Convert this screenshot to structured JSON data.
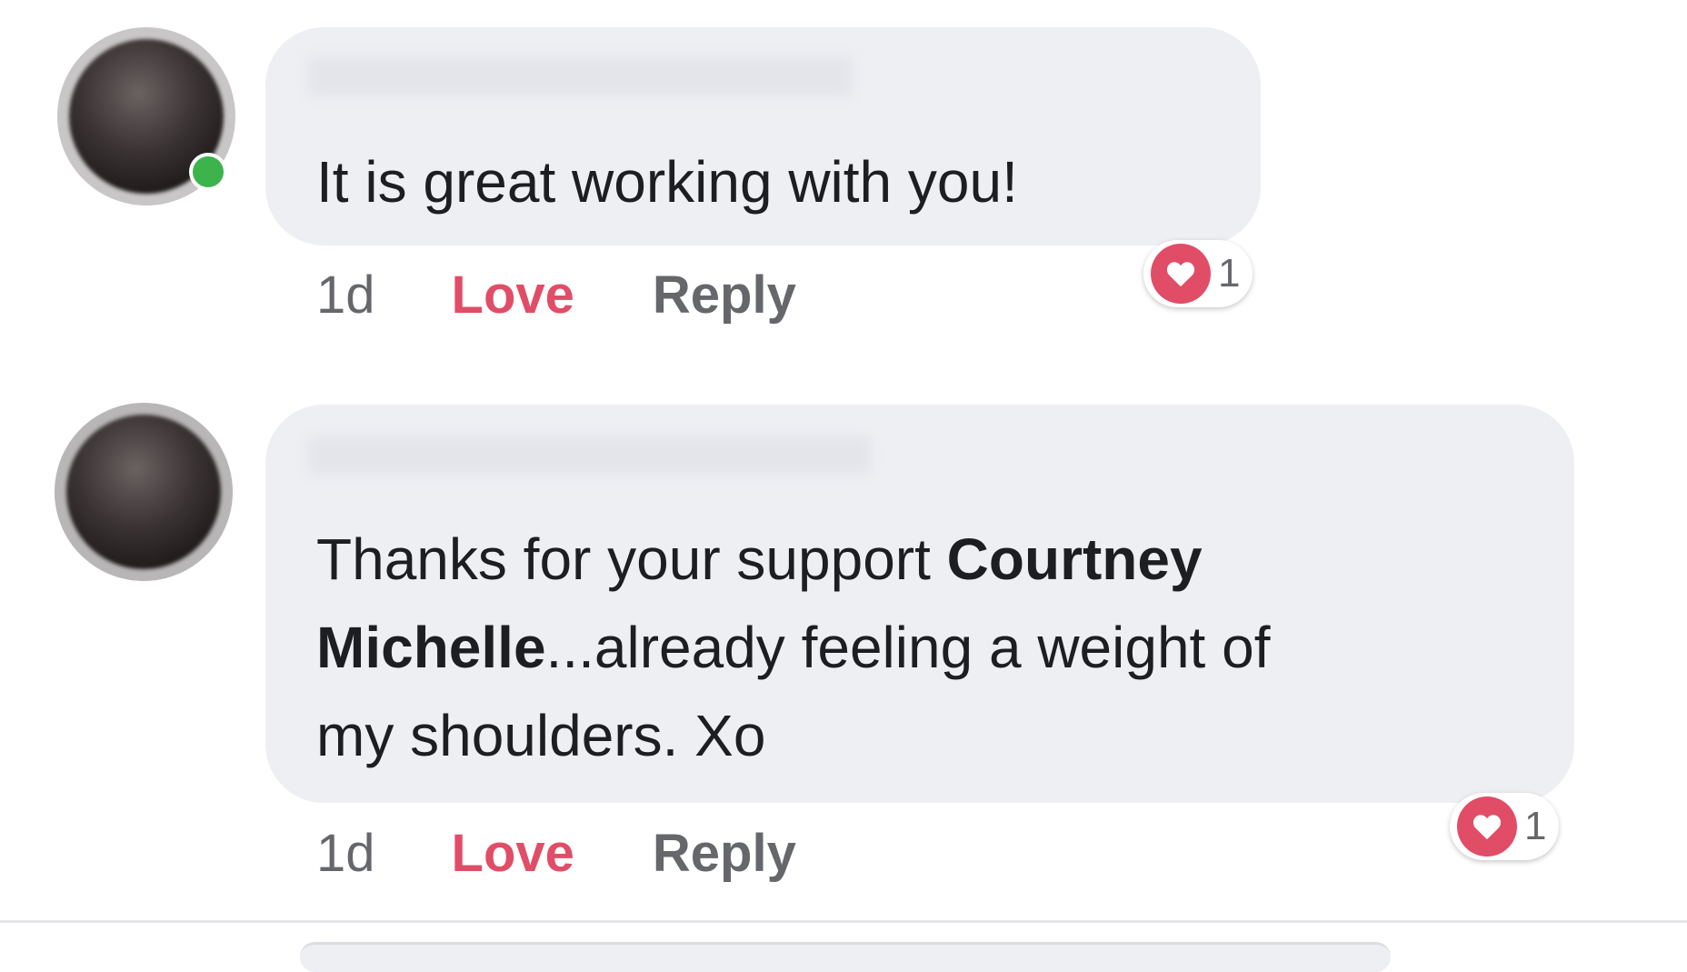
{
  "comments": [
    {
      "text": "It is great working with you!",
      "timestamp": "1d",
      "love_label": "Love",
      "reply_label": "Reply",
      "reaction_count": "1",
      "online": true
    },
    {
      "text_segments": [
        "Thanks for your support ",
        "Courtney",
        "Michelle",
        "...already feeling a weight of",
        "my shoulders. Xo"
      ],
      "mention": "Courtney Michelle",
      "timestamp": "1d",
      "love_label": "Love",
      "reply_label": "Reply",
      "reaction_count": "1",
      "online": false
    }
  ],
  "colors": {
    "love": "#e14d67",
    "bubble": "#eeeff3",
    "muted": "#65676b",
    "online": "#3cb44b"
  }
}
